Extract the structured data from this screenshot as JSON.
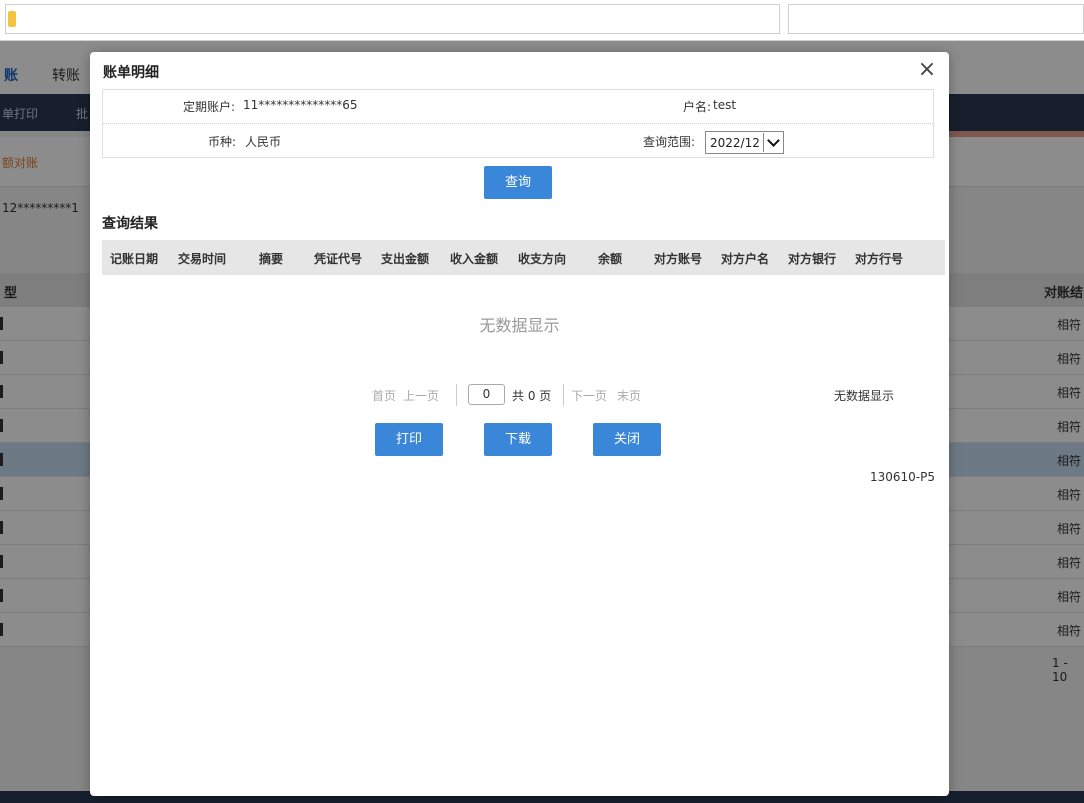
{
  "background": {
    "menu": [
      "账",
      "转账"
    ],
    "nav": [
      "单打印",
      "批"
    ],
    "sub_tab": "额对账",
    "account_fragment": "12*********1",
    "table_head_left": "型",
    "table_head_right": "对账结",
    "row_result": "相符",
    "rows": 10,
    "selected_row_index": 4,
    "pager_fragment": "1 - 10"
  },
  "modal": {
    "title": "账单明细",
    "close_icon": "×",
    "info": {
      "account_label": "定期账户:",
      "account_value": "11**************65",
      "name_label": "户名:",
      "name_value": "test",
      "currency_label": "币种:",
      "currency_value": "人民币",
      "range_label": "查询范围:",
      "range_value": "2022/12"
    },
    "query_button": "查询",
    "result_title": "查询结果",
    "columns": [
      "记账日期",
      "交易时间",
      "摘要",
      "凭证代号",
      "支出金额",
      "收入金额",
      "收支方向",
      "余额",
      "对方账号",
      "对方户名",
      "对方银行",
      "对方行号"
    ],
    "empty_message": "无数据显示",
    "pager": {
      "first": "首页",
      "prev": "上一页",
      "page_number": "0",
      "total": "共 0 页",
      "next": "下一页",
      "last": "末页",
      "status": "无数据显示"
    },
    "buttons": {
      "print": "打印",
      "download": "下载",
      "close": "关闭"
    },
    "page_code": "130610-P5"
  },
  "colors": {
    "accent": "#3a86d9",
    "nav_bg": "#2b3a55",
    "selected_row": "#c6dcf3",
    "orange_tab": "#e27b2f"
  }
}
